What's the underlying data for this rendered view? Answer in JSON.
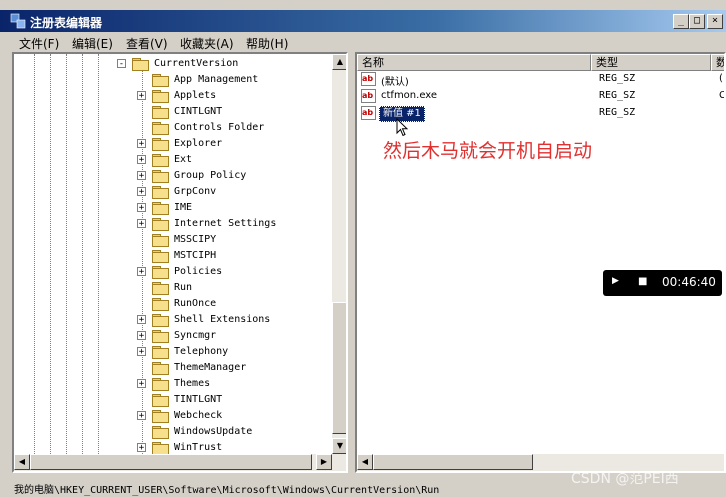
{
  "window": {
    "title": "注册表编辑器"
  },
  "menu": [
    "文件(F)",
    "编辑(E)",
    "查看(V)",
    "收藏夹(A)",
    "帮助(H)"
  ],
  "tree": {
    "items": [
      {
        "label": "CurrentVersion",
        "expander": "-"
      },
      {
        "label": "App Management",
        "expander": ""
      },
      {
        "label": "Applets",
        "expander": "+"
      },
      {
        "label": "CINTLGNT",
        "expander": ""
      },
      {
        "label": "Controls Folder",
        "expander": ""
      },
      {
        "label": "Explorer",
        "expander": "+"
      },
      {
        "label": "Ext",
        "expander": "+"
      },
      {
        "label": "Group Policy",
        "expander": "+"
      },
      {
        "label": "GrpConv",
        "expander": "+"
      },
      {
        "label": "IME",
        "expander": "+"
      },
      {
        "label": "Internet Settings",
        "expander": "+"
      },
      {
        "label": "MSSCIPY",
        "expander": ""
      },
      {
        "label": "MSTCIPH",
        "expander": ""
      },
      {
        "label": "Policies",
        "expander": "+"
      },
      {
        "label": "Run",
        "expander": ""
      },
      {
        "label": "RunOnce",
        "expander": ""
      },
      {
        "label": "Shell Extensions",
        "expander": "+"
      },
      {
        "label": "Syncmgr",
        "expander": "+"
      },
      {
        "label": "Telephony",
        "expander": "+"
      },
      {
        "label": "ThemeManager",
        "expander": ""
      },
      {
        "label": "Themes",
        "expander": "+"
      },
      {
        "label": "TINTLGNT",
        "expander": ""
      },
      {
        "label": "Webcheck",
        "expander": "+"
      },
      {
        "label": "WindowsUpdate",
        "expander": ""
      },
      {
        "label": "WinTrust",
        "expander": "+"
      }
    ]
  },
  "list": {
    "headers": {
      "name": "名称",
      "type": "类型",
      "data": "数"
    },
    "rows": [
      {
        "name": "(默认)",
        "type": "REG_SZ",
        "data": "(",
        "selected": false
      },
      {
        "name": "ctfmon.exe",
        "type": "REG_SZ",
        "data": "C",
        "selected": false
      },
      {
        "name": "新值 #1",
        "type": "REG_SZ",
        "data": "",
        "selected": true
      }
    ]
  },
  "annotation": "然后木马就会开机自启动",
  "media": {
    "play": "▶",
    "stop": "■",
    "time": "00:46:40"
  },
  "status": {
    "path": "我的电脑\\HKEY_CURRENT_USER\\Software\\Microsoft\\Windows\\CurrentVersion\\Run"
  },
  "watermark": "CSDN @范PEI西",
  "colors": {
    "titlebar": "#0a246a",
    "selection": "#0a246a",
    "annotation": "#e03030"
  }
}
